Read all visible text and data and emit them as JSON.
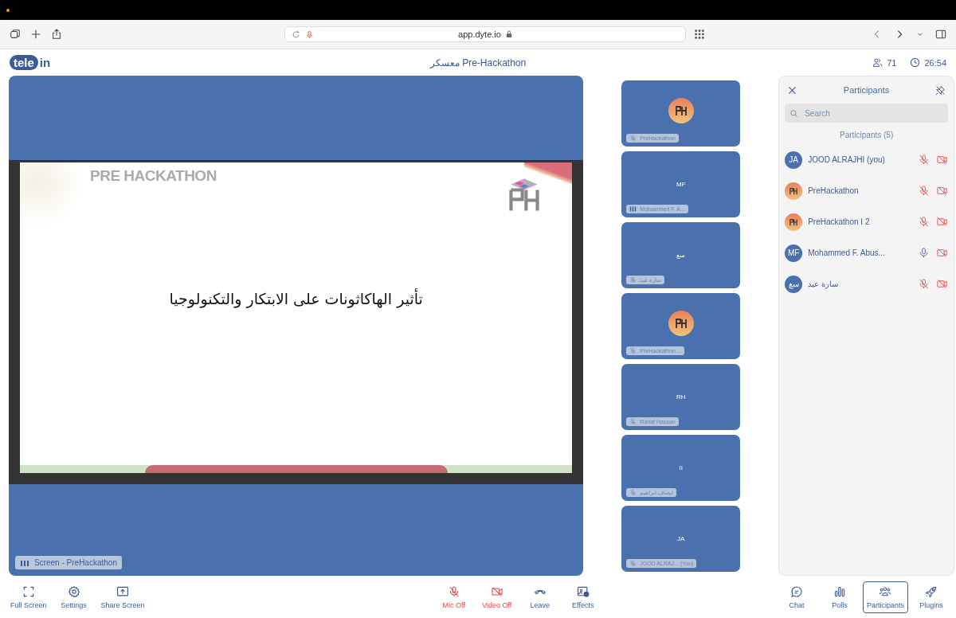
{
  "browser": {
    "address": "app.dyte.io"
  },
  "header": {
    "logo_left": "tele",
    "logo_right": "in",
    "title": "معسكر Pre-Hackathon",
    "participant_count": "71",
    "timer": "26:54"
  },
  "stage": {
    "slide_heading": "PRE HACKATHON",
    "slide_text": "تأثير الهاكاثونات على الابتكار والتكنولوجيا",
    "label": "Screen - PreHackathon"
  },
  "tiles": [
    {
      "kind": "logo",
      "name": "PreHackathon",
      "muted": true
    },
    {
      "kind": "initials",
      "initials": "MF",
      "name": "Mohammed F. A...",
      "muted": false
    },
    {
      "kind": "initials",
      "initials": "سع",
      "name": "سارة عيد",
      "muted": true
    },
    {
      "kind": "logo",
      "name": "PreHackathon ...",
      "muted": true
    },
    {
      "kind": "initials",
      "initials": "RH",
      "name": "Rahaf Hassan",
      "muted": true
    },
    {
      "kind": "initials",
      "initials": "II",
      "name": "ايصاف ابراهيم",
      "muted": true
    },
    {
      "kind": "initials",
      "initials": "JA",
      "name": "JOOD ALRAJ... (You)",
      "muted": true
    }
  ],
  "panel": {
    "title": "Participants",
    "search": {
      "placeholder": "Search"
    },
    "count_label": "Participants (5)",
    "participants": [
      {
        "kind": "initials",
        "initials": "JA",
        "name": "JOOD ALRAJHI (you)",
        "mic_on": false,
        "video_on": false
      },
      {
        "kind": "logo",
        "name": "PreHackathon",
        "mic_on": false,
        "video_on": false
      },
      {
        "kind": "logo",
        "name": "PreHackathon I 2",
        "mic_on": false,
        "video_on": false
      },
      {
        "kind": "initials",
        "initials": "MF",
        "name": "Mohammed F. Abus...",
        "mic_on": true,
        "video_on": false
      },
      {
        "kind": "initials",
        "initials": "سع",
        "name": "سارة عيد",
        "mic_on": false,
        "video_on": false
      }
    ]
  },
  "controls_left": [
    {
      "kind": "fullscreen",
      "label": "Full Screen"
    },
    {
      "kind": "settings",
      "label": "Settings"
    },
    {
      "kind": "share",
      "label": "Share Screen"
    }
  ],
  "controls_center": [
    {
      "kind": "mic",
      "label": "Mic Off",
      "off": true
    },
    {
      "kind": "video",
      "label": "Video Off",
      "off": true
    },
    {
      "kind": "leave",
      "label": "Leave",
      "off": false
    },
    {
      "kind": "effects",
      "label": "Effects",
      "off": false
    }
  ],
  "controls_right": [
    {
      "kind": "chat",
      "label": "Chat",
      "selected": false
    },
    {
      "kind": "polls",
      "label": "Polls",
      "selected": false
    },
    {
      "kind": "participants",
      "label": "Participants",
      "selected": true
    },
    {
      "kind": "plugins",
      "label": "Plugins",
      "selected": false
    }
  ]
}
